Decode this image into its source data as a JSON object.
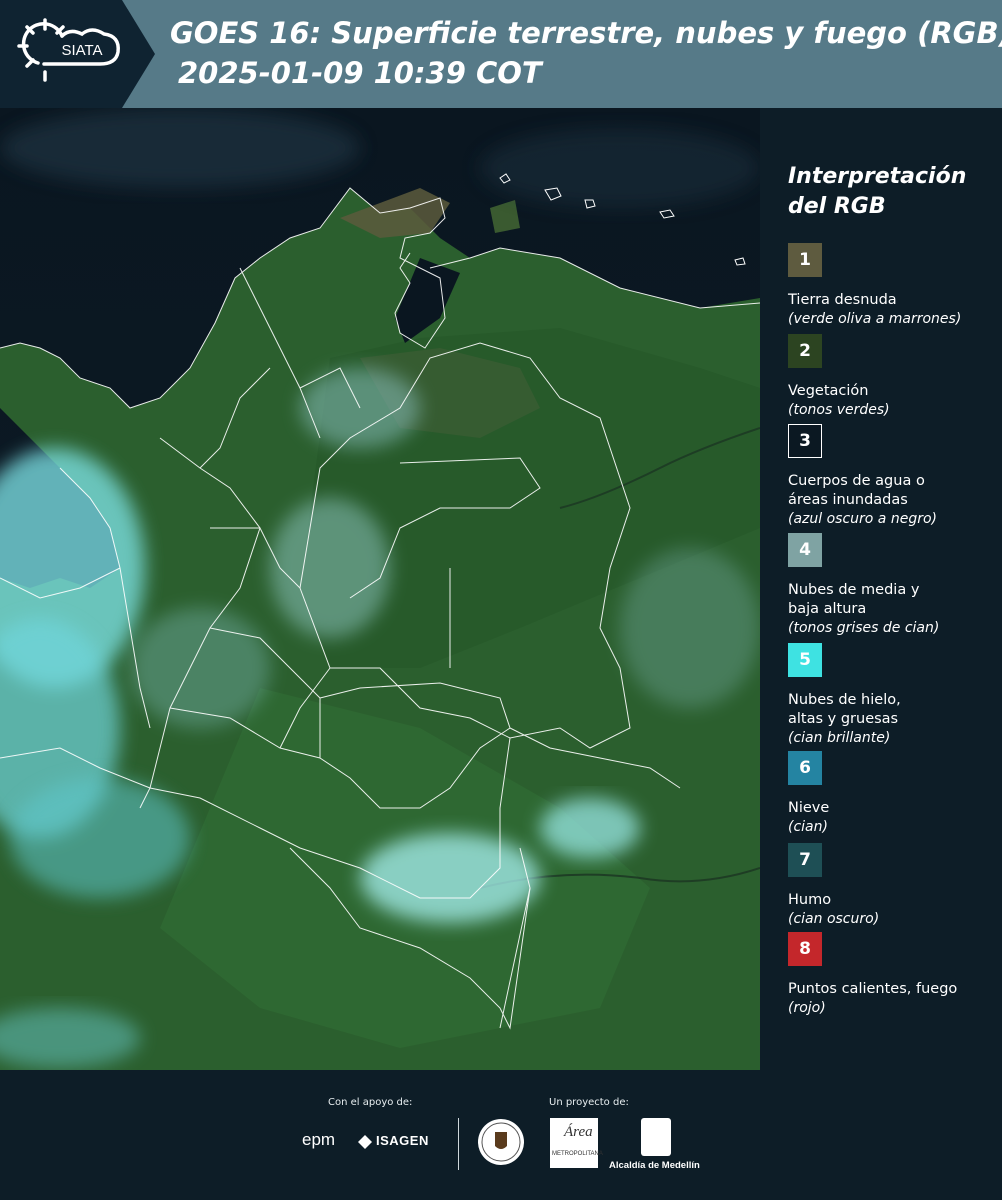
{
  "header": {
    "logo_text": "SIATA",
    "title_line1": "GOES 16: Superficie terrestre, nubes y fuego (RGB)",
    "title_line2": "2025-01-09 10:39 COT"
  },
  "legend": {
    "title_line1": "Interpretación",
    "title_line2": "del RGB",
    "items": [
      {
        "number": "1",
        "color": "#5e5b3f",
        "label": "Tierra desnuda",
        "sub": "(verde oliva a marrones)"
      },
      {
        "number": "2",
        "color": "#2c4421",
        "label": "Vegetación",
        "sub": "(tonos verdes)"
      },
      {
        "number": "3",
        "color": "#0b1822",
        "label": "Cuerpos de agua o áreas inundadas",
        "sub": "(azul oscuro a negro)"
      },
      {
        "number": "4",
        "color": "#7fa3a3",
        "label": "Nubes de media y baja altura",
        "sub": "(tonos grises de cian)"
      },
      {
        "number": "5",
        "color": "#3ee2e2",
        "label": "Nubes de hielo, altas y gruesas",
        "sub": "(cian brillante)"
      },
      {
        "number": "6",
        "color": "#2484a2",
        "label": "Nieve",
        "sub": "(cian)"
      },
      {
        "number": "7",
        "color": "#1e4f55",
        "label": "Humo",
        "sub": "(cian oscuro)"
      },
      {
        "number": "8",
        "color": "#c4272b",
        "label": "Puntos calientes, fuego",
        "sub": "(rojo)"
      }
    ]
  },
  "footer": {
    "support_label": "Con el apoyo de:",
    "project_label": "Un proyecto de:",
    "epm": "epm",
    "isagen": "ISAGEN",
    "area_metro": "Área",
    "area_metro_sub": "METROPOLITANA",
    "alcaldia": "Alcaldía de Medellín"
  }
}
